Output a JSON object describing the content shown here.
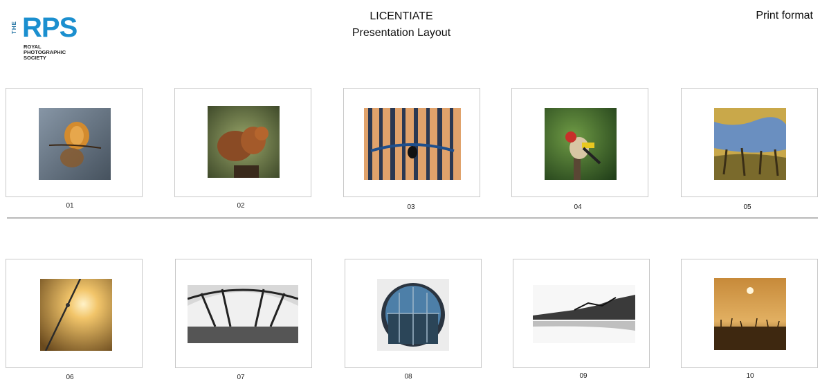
{
  "header": {
    "logo": {
      "org_line1": "ROYAL",
      "org_line2": "PHOTOGRAPHIC",
      "org_line3": "SOCIETY",
      "mark": "RPS",
      "the": "THE"
    },
    "title_line1": "LICENTIATE",
    "title_line2": "Presentation Layout",
    "format": "Print format"
  },
  "row1": {
    "labels": [
      "01",
      "02",
      "03",
      "04",
      "05"
    ]
  },
  "row2": {
    "labels": [
      "06",
      "07",
      "08",
      "09",
      "10"
    ]
  },
  "colors": {
    "brand": "#1b8fcf",
    "mount_border": "#c8c8c8",
    "divider": "#b9b9b9"
  }
}
